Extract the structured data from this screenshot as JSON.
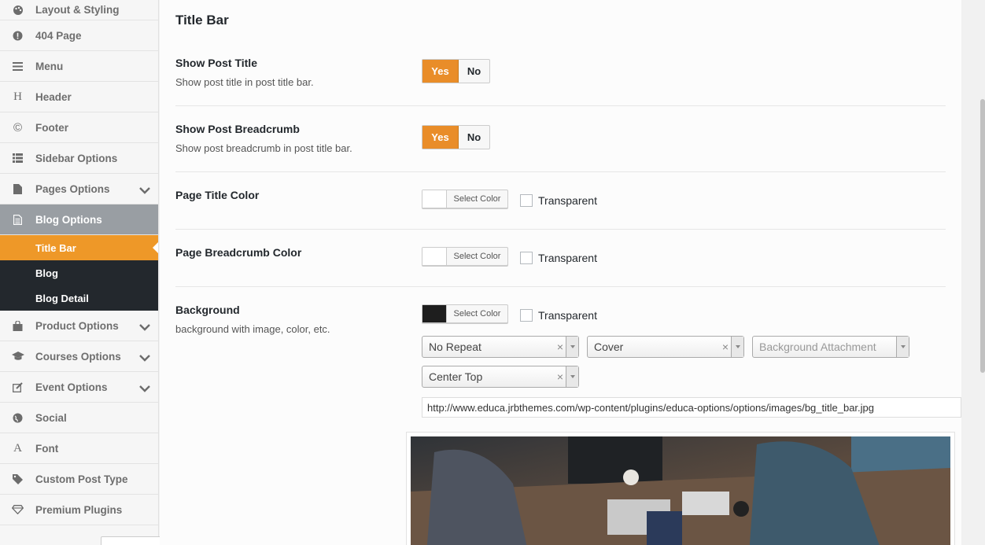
{
  "sidebar": {
    "items": [
      {
        "label": "Layout & Styling",
        "icon": "palette-icon"
      },
      {
        "label": "404 Page",
        "icon": "exclamation-icon"
      },
      {
        "label": "Menu",
        "icon": "menu-icon"
      },
      {
        "label": "Header",
        "icon": "header-icon"
      },
      {
        "label": "Footer",
        "icon": "copyright-icon"
      },
      {
        "label": "Sidebar Options",
        "icon": "list-icon"
      },
      {
        "label": "Pages Options",
        "icon": "page-icon"
      },
      {
        "label": "Blog Options",
        "icon": "document-icon"
      },
      {
        "label": "Product Options",
        "icon": "bag-icon"
      },
      {
        "label": "Courses Options",
        "icon": "graduation-cap-icon"
      },
      {
        "label": "Event Options",
        "icon": "edit-icon"
      },
      {
        "label": "Social",
        "icon": "globe-icon"
      },
      {
        "label": "Font",
        "icon": "font-icon"
      },
      {
        "label": "Custom Post Type",
        "icon": "tags-icon"
      },
      {
        "label": "Premium Plugins",
        "icon": "diamond-icon"
      }
    ],
    "blog_sub": [
      "Title Bar",
      "Blog",
      "Blog Detail"
    ]
  },
  "main": {
    "section_title": "Title Bar",
    "show_post_title": {
      "title": "Show Post Title",
      "desc": "Show post title in post title bar.",
      "yes": "Yes",
      "no": "No",
      "value": "Yes"
    },
    "show_post_breadcrumb": {
      "title": "Show Post Breadcrumb",
      "desc": "Show post breadcrumb in post title bar.",
      "yes": "Yes",
      "no": "No",
      "value": "Yes"
    },
    "page_title_color": {
      "title": "Page Title Color",
      "button": "Select Color",
      "transparent": "Transparent",
      "swatch": "#ffffff"
    },
    "page_breadcrumb_color": {
      "title": "Page Breadcrumb Color",
      "button": "Select Color",
      "transparent": "Transparent",
      "swatch": "#ffffff"
    },
    "background": {
      "title": "Background",
      "desc": "background with image, color, etc.",
      "button": "Select Color",
      "transparent": "Transparent",
      "swatch": "#1e1e1e",
      "repeat": "No Repeat",
      "size": "Cover",
      "attachment_placeholder": "Background Attachment",
      "position": "Center Top",
      "url": "http://www.educa.jrbthemes.com/wp-content/plugins/educa-options/options/images/bg_title_bar.jpg"
    }
  },
  "colors": {
    "accent": "#ee9828",
    "toggle_yes": "#e98d29",
    "active_nav": "#999ea3",
    "submenu_bg": "#23282d"
  }
}
